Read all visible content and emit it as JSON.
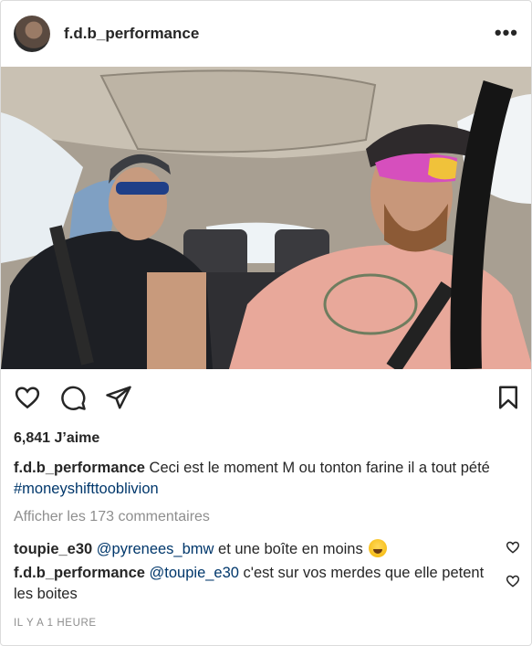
{
  "post": {
    "username": "f.d.b_performance",
    "more_label": "•••"
  },
  "photo": {
    "alt_subject": "two-men-in-car"
  },
  "actions": {
    "like_icon": "heart-icon",
    "comment_icon": "comment-icon",
    "share_icon": "send-icon",
    "save_icon": "bookmark-icon"
  },
  "likes": "6,841 J’aime",
  "caption": {
    "username": "f.d.b_performance",
    "text": "Ceci est le moment M ou tonton farine il a tout pété",
    "hashtag": "#moneyshifttooblivion"
  },
  "view_comments": "Afficher les 173 commentaires",
  "comments": [
    {
      "username": "toupie_e30",
      "mention": "@pyrenees_bmw",
      "text": " et une boîte en moins",
      "emoji": "grinning-sweat-emoji"
    },
    {
      "username": "f.d.b_performance",
      "mention": "@toupie_e30",
      "text": " c'est sur vos merdes que elle petent les boites"
    }
  ],
  "timestamp": "IL Y A 1 HEURE",
  "colors": {
    "text": "#262626",
    "muted": "#8e8e8e",
    "link": "#00376b",
    "border": "#dbdbdb"
  }
}
